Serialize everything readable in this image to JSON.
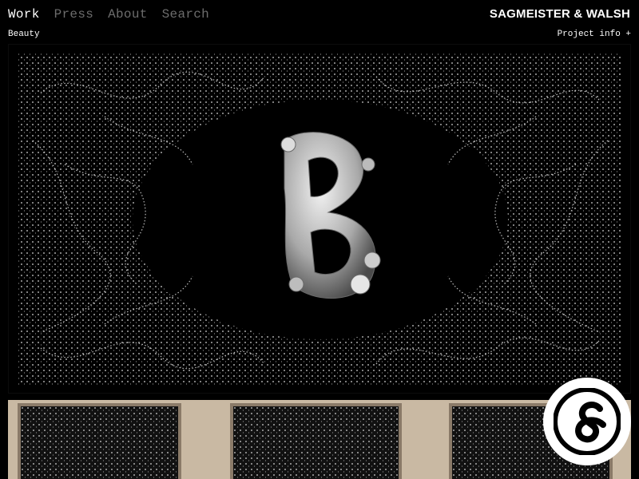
{
  "nav": {
    "items": [
      {
        "label": "Work",
        "active": true
      },
      {
        "label": "Press",
        "active": false
      },
      {
        "label": "About",
        "active": false
      },
      {
        "label": "Search",
        "active": false
      }
    ]
  },
  "brand": {
    "name": "SAGMEISTER & WALSH"
  },
  "project": {
    "title": "Beauty",
    "info_label": "Project info +"
  },
  "colors": {
    "background": "#000000",
    "text": "#ffffff",
    "nav_inactive": "#6d6d6d",
    "wood": "#c9b9a3"
  },
  "icons": {
    "logo": "ampersand-logo-icon"
  }
}
